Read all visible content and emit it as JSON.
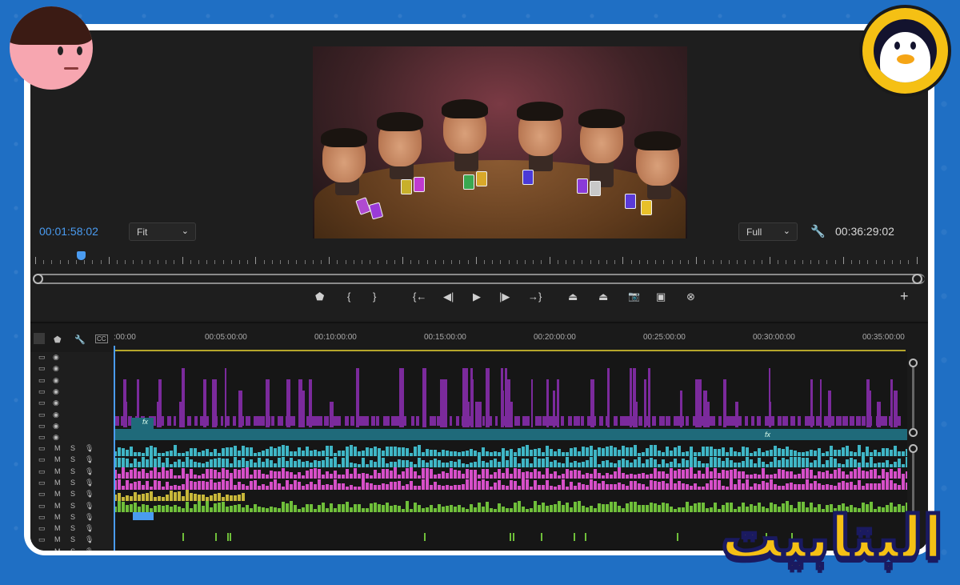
{
  "monitor": {
    "timecode_current": "00:01:58:02",
    "fit_select": "Fit",
    "quality_select": "Full",
    "timecode_duration": "00:36:29:02"
  },
  "transport": {
    "buttons": [
      "add-marker",
      "mark-in",
      "mark-out",
      "go-to-in",
      "step-back",
      "play",
      "step-forward",
      "go-to-out",
      "lift",
      "extract",
      "export-frame",
      "comparison-view",
      "button-editor"
    ],
    "glyphs": {
      "marker": "⬟",
      "mark_in": "{",
      "mark_out": "}",
      "go_in": "{←",
      "step_back": "◀|",
      "play": "▶",
      "step_fwd": "|▶",
      "go_out": "→}",
      "lift": "⏏",
      "extract": "⏏",
      "camera": "📷",
      "compare": "▣",
      "plus": "+"
    }
  },
  "timeline": {
    "ruler_labels": [
      ":00:00",
      "00:05:00:00",
      "00:10:00:00",
      "00:15:00:00",
      "00:20:00:00",
      "00:25:00:00",
      "00:30:00:00",
      "00:35:00:00"
    ],
    "fx_label": "fx",
    "audio_track_labels": {
      "mute": "M",
      "solo": "S"
    }
  },
  "overlay": {
    "logo_text": "البتابيت"
  },
  "colors": {
    "accent_blue": "#4a9bf0",
    "clip_purple": "#7b2a9c",
    "clip_teal": "#1f6a7a",
    "audio_cyan": "#3fb6c6",
    "audio_pink": "#d64fc8",
    "audio_green": "#6fbf3a",
    "audio_yellow": "#c8b83a"
  }
}
